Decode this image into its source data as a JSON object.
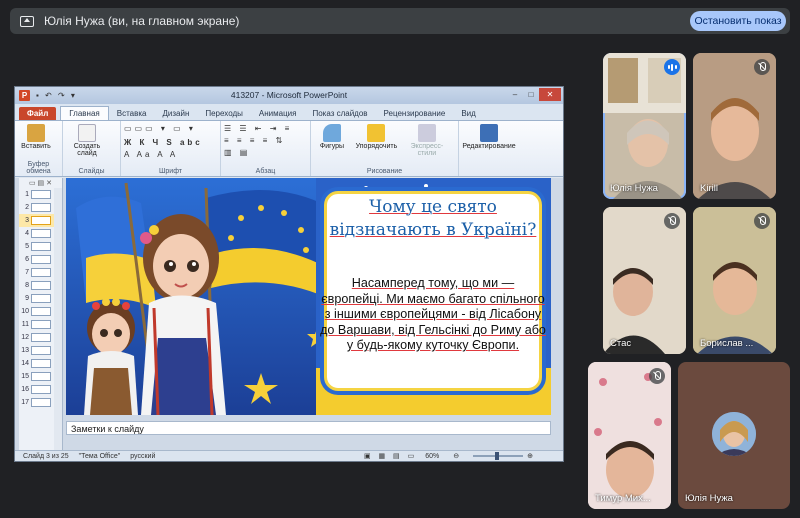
{
  "meet": {
    "banner_text": "Юлія Нужа (ви, на главном экране)",
    "stop_button": "Остановить показ",
    "tiles": [
      {
        "name": "Юлія Нужа",
        "muted": false,
        "speaking": true
      },
      {
        "name": "Kirill",
        "muted": true
      },
      {
        "name": "Стас",
        "muted": true
      },
      {
        "name": "Борислав ...",
        "muted": true
      },
      {
        "name": "Тимур Мих...",
        "muted": true
      },
      {
        "name": "Юлія Нужа",
        "muted": false
      }
    ]
  },
  "ppt": {
    "window_title": "413207 - Microsoft PowerPoint",
    "logo_letter": "P",
    "tabs": [
      "Файл",
      "Главная",
      "Вставка",
      "Дизайн",
      "Переходы",
      "Анимация",
      "Показ слайдов",
      "Рецензирование",
      "Вид"
    ],
    "ribbon": {
      "paste": "Вставить",
      "new_slide": "Создать слайд",
      "shapes": "Фигуры",
      "arrange": "Упорядочить",
      "quick_styles": "Экспресс-стили",
      "editing": "Редактирование",
      "groups": [
        "Буфер обмена",
        "Слайды",
        "Шрифт",
        "Абзац",
        "Рисование"
      ],
      "font_row1": "Ж К Ч S abc",
      "font_row2": "A Aa A A"
    },
    "thumbnail_numbers": [
      "1",
      "2",
      "3",
      "4",
      "5",
      "6",
      "7",
      "8",
      "9",
      "10",
      "11",
      "12",
      "13",
      "14",
      "15",
      "16",
      "17"
    ],
    "selected_slide": 3,
    "slide": {
      "heading": "Чому це свято відзначають в Україні?",
      "body": "Насамперед тому, що ми — європейці. Ми маємо багато спільного з іншими європейцями - від Лісабону до Варшави, від Гельсінкі до Риму або у будь-якому куточку Європи."
    },
    "notes_placeholder": "Заметки к слайду",
    "status": {
      "slide_of": "Слайд 3 из 25",
      "theme": "\"Тема Office\"",
      "language": "русский",
      "zoom": "60%"
    }
  }
}
